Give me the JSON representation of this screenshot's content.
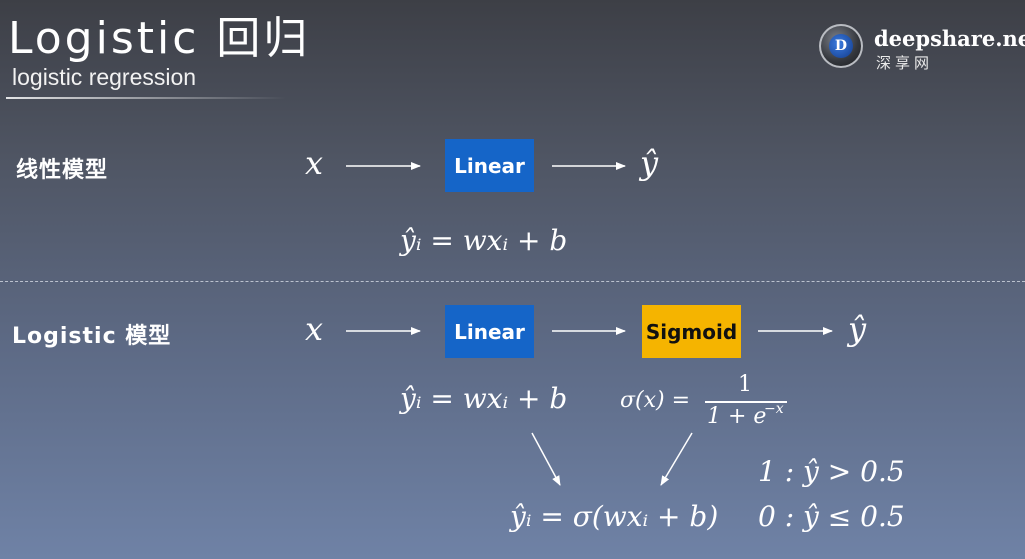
{
  "header": {
    "title": "Logistic 回归",
    "subtitle": "logistic regression"
  },
  "logo": {
    "letter": "D",
    "name": "deepshare.net",
    "subtitle_cn": "深享网"
  },
  "linear_model": {
    "label": "线性模型",
    "input": "x",
    "box_label": "Linear",
    "output": "ŷ",
    "equation": "ŷᵢ = wxᵢ + b"
  },
  "logistic_model": {
    "label": "Logistic 模型",
    "input": "x",
    "linear_box_label": "Linear",
    "sigmoid_box_label": "Sigmoid",
    "output": "ŷ",
    "linear_equation": "ŷᵢ = wxᵢ + b",
    "sigmoid_lhs": "σ(x) =",
    "sigmoid_numerator": "1",
    "sigmoid_denominator": "1 + e",
    "sigmoid_exponent": "−x",
    "combined_equation": "ŷᵢ = σ(wxᵢ + b)",
    "rule_1": "1 : ŷ > 0.5",
    "rule_0": "0 : ŷ ≤ 0.5"
  },
  "colors": {
    "linear_box": "#1565c8",
    "sigmoid_box": "#f5b400"
  }
}
